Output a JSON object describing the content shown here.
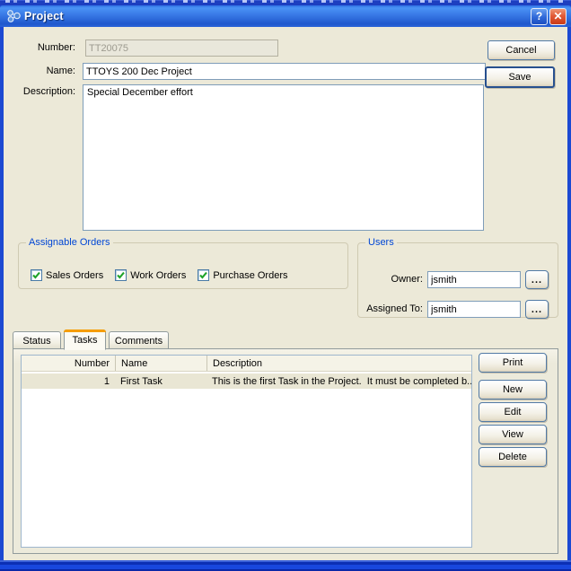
{
  "window": {
    "title": "Project",
    "help_glyph": "?",
    "close_glyph": "✕"
  },
  "actions": {
    "cancel": "Cancel",
    "save": "Save"
  },
  "form": {
    "number_label": "Number:",
    "number_value": "TT20075",
    "name_label": "Name:",
    "name_value": "TTOYS 200 Dec Project",
    "description_label": "Description:",
    "description_value": "Special December effort"
  },
  "assignable_orders": {
    "legend": "Assignable Orders",
    "items": [
      {
        "label": "Sales Orders",
        "checked": true
      },
      {
        "label": "Work Orders",
        "checked": true
      },
      {
        "label": "Purchase Orders",
        "checked": true
      }
    ]
  },
  "users": {
    "legend": "Users",
    "owner_label": "Owner:",
    "owner_value": "jsmith",
    "assigned_label": "Assigned To:",
    "assigned_value": "jsmith",
    "browse_label": "..."
  },
  "tabs": [
    {
      "label": "Status",
      "active": false
    },
    {
      "label": "Tasks",
      "active": true
    },
    {
      "label": "Comments",
      "active": false
    }
  ],
  "tasks": {
    "columns": [
      "Number",
      "Name",
      "Description"
    ],
    "rows": [
      {
        "number": "1",
        "name": "First Task",
        "description": "This is the first Task in the Project.  It must be completed b..."
      }
    ]
  },
  "task_buttons": [
    "Print",
    "New",
    "Edit",
    "View",
    "Delete"
  ],
  "colors": {
    "titlebar_blue": "#2f6fe3",
    "frame_blue": "#1c49d2",
    "client_beige": "#ece9d8",
    "legend_blue": "#0046d5",
    "check_green": "#1fa32a",
    "active_tab_orange": "#f59d00",
    "close_red": "#d6492a",
    "input_border": "#7f9db9"
  }
}
